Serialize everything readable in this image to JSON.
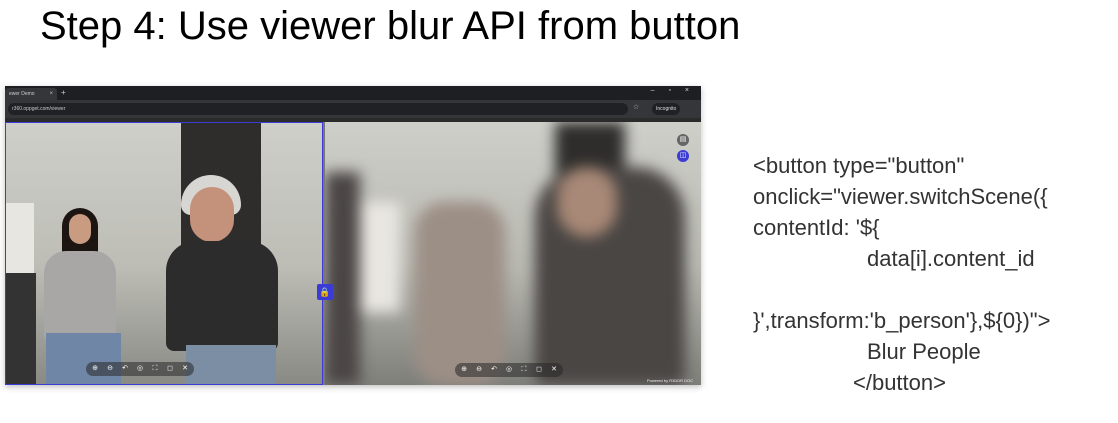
{
  "slide": {
    "title": "Step 4: Use viewer blur API from button"
  },
  "browser": {
    "tab_title": "ewer Demo",
    "tab_close": "×",
    "new_tab": "+",
    "window_controls": "– ▫ ×",
    "url": "r360.oppget.com/viewer",
    "bookmark_icon": "☆",
    "incognito_label": "Incognito",
    "powered_by": "Powered by R3DDR DOC"
  },
  "viewer": {
    "lock_icon": "🔒",
    "tools": [
      "⊕",
      "⊖",
      "↶",
      "◎",
      "⛶",
      "◻",
      "✕"
    ],
    "right_tools": [
      "⊕",
      "⊖",
      "↶",
      "◎",
      "⛶",
      "◻",
      "✕"
    ],
    "accent": "#3b3bd6"
  },
  "code": {
    "lines": [
      "<button type=\"button\"",
      "onclick=\"viewer.switchScene({",
      "contentId: '${",
      "data[i].content_id",
      "",
      "}',transform:'b_person'},${0})\">",
      "Blur People",
      "</button>"
    ]
  }
}
